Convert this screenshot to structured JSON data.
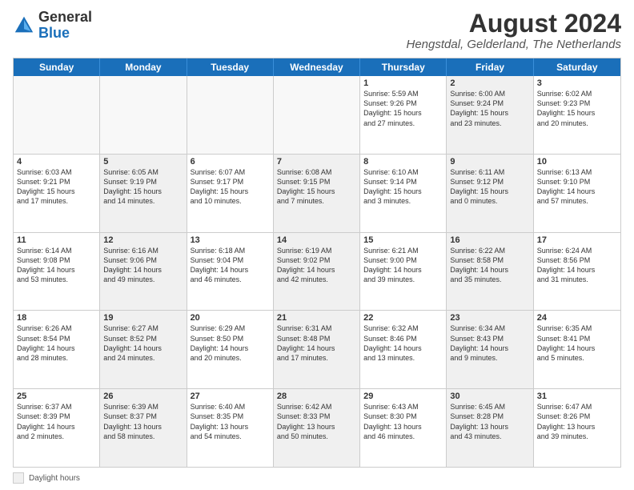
{
  "header": {
    "logo_general": "General",
    "logo_blue": "Blue",
    "main_title": "August 2024",
    "subtitle": "Hengstdal, Gelderland, The Netherlands"
  },
  "calendar": {
    "days_of_week": [
      "Sunday",
      "Monday",
      "Tuesday",
      "Wednesday",
      "Thursday",
      "Friday",
      "Saturday"
    ],
    "weeks": [
      [
        {
          "day": "",
          "empty": true
        },
        {
          "day": "",
          "empty": true
        },
        {
          "day": "",
          "empty": true
        },
        {
          "day": "",
          "empty": true
        },
        {
          "day": "1",
          "info": "Sunrise: 5:59 AM\nSunset: 9:26 PM\nDaylight: 15 hours\nand 27 minutes."
        },
        {
          "day": "2",
          "info": "Sunrise: 6:00 AM\nSunset: 9:24 PM\nDaylight: 15 hours\nand 23 minutes.",
          "shaded": true
        },
        {
          "day": "3",
          "info": "Sunrise: 6:02 AM\nSunset: 9:23 PM\nDaylight: 15 hours\nand 20 minutes."
        }
      ],
      [
        {
          "day": "4",
          "info": "Sunrise: 6:03 AM\nSunset: 9:21 PM\nDaylight: 15 hours\nand 17 minutes."
        },
        {
          "day": "5",
          "info": "Sunrise: 6:05 AM\nSunset: 9:19 PM\nDaylight: 15 hours\nand 14 minutes.",
          "shaded": true
        },
        {
          "day": "6",
          "info": "Sunrise: 6:07 AM\nSunset: 9:17 PM\nDaylight: 15 hours\nand 10 minutes."
        },
        {
          "day": "7",
          "info": "Sunrise: 6:08 AM\nSunset: 9:15 PM\nDaylight: 15 hours\nand 7 minutes.",
          "shaded": true
        },
        {
          "day": "8",
          "info": "Sunrise: 6:10 AM\nSunset: 9:14 PM\nDaylight: 15 hours\nand 3 minutes."
        },
        {
          "day": "9",
          "info": "Sunrise: 6:11 AM\nSunset: 9:12 PM\nDaylight: 15 hours\nand 0 minutes.",
          "shaded": true
        },
        {
          "day": "10",
          "info": "Sunrise: 6:13 AM\nSunset: 9:10 PM\nDaylight: 14 hours\nand 57 minutes."
        }
      ],
      [
        {
          "day": "11",
          "info": "Sunrise: 6:14 AM\nSunset: 9:08 PM\nDaylight: 14 hours\nand 53 minutes."
        },
        {
          "day": "12",
          "info": "Sunrise: 6:16 AM\nSunset: 9:06 PM\nDaylight: 14 hours\nand 49 minutes.",
          "shaded": true
        },
        {
          "day": "13",
          "info": "Sunrise: 6:18 AM\nSunset: 9:04 PM\nDaylight: 14 hours\nand 46 minutes."
        },
        {
          "day": "14",
          "info": "Sunrise: 6:19 AM\nSunset: 9:02 PM\nDaylight: 14 hours\nand 42 minutes.",
          "shaded": true
        },
        {
          "day": "15",
          "info": "Sunrise: 6:21 AM\nSunset: 9:00 PM\nDaylight: 14 hours\nand 39 minutes."
        },
        {
          "day": "16",
          "info": "Sunrise: 6:22 AM\nSunset: 8:58 PM\nDaylight: 14 hours\nand 35 minutes.",
          "shaded": true
        },
        {
          "day": "17",
          "info": "Sunrise: 6:24 AM\nSunset: 8:56 PM\nDaylight: 14 hours\nand 31 minutes."
        }
      ],
      [
        {
          "day": "18",
          "info": "Sunrise: 6:26 AM\nSunset: 8:54 PM\nDaylight: 14 hours\nand 28 minutes."
        },
        {
          "day": "19",
          "info": "Sunrise: 6:27 AM\nSunset: 8:52 PM\nDaylight: 14 hours\nand 24 minutes.",
          "shaded": true
        },
        {
          "day": "20",
          "info": "Sunrise: 6:29 AM\nSunset: 8:50 PM\nDaylight: 14 hours\nand 20 minutes."
        },
        {
          "day": "21",
          "info": "Sunrise: 6:31 AM\nSunset: 8:48 PM\nDaylight: 14 hours\nand 17 minutes.",
          "shaded": true
        },
        {
          "day": "22",
          "info": "Sunrise: 6:32 AM\nSunset: 8:46 PM\nDaylight: 14 hours\nand 13 minutes."
        },
        {
          "day": "23",
          "info": "Sunrise: 6:34 AM\nSunset: 8:43 PM\nDaylight: 14 hours\nand 9 minutes.",
          "shaded": true
        },
        {
          "day": "24",
          "info": "Sunrise: 6:35 AM\nSunset: 8:41 PM\nDaylight: 14 hours\nand 5 minutes."
        }
      ],
      [
        {
          "day": "25",
          "info": "Sunrise: 6:37 AM\nSunset: 8:39 PM\nDaylight: 14 hours\nand 2 minutes."
        },
        {
          "day": "26",
          "info": "Sunrise: 6:39 AM\nSunset: 8:37 PM\nDaylight: 13 hours\nand 58 minutes.",
          "shaded": true
        },
        {
          "day": "27",
          "info": "Sunrise: 6:40 AM\nSunset: 8:35 PM\nDaylight: 13 hours\nand 54 minutes."
        },
        {
          "day": "28",
          "info": "Sunrise: 6:42 AM\nSunset: 8:33 PM\nDaylight: 13 hours\nand 50 minutes.",
          "shaded": true
        },
        {
          "day": "29",
          "info": "Sunrise: 6:43 AM\nSunset: 8:30 PM\nDaylight: 13 hours\nand 46 minutes."
        },
        {
          "day": "30",
          "info": "Sunrise: 6:45 AM\nSunset: 8:28 PM\nDaylight: 13 hours\nand 43 minutes.",
          "shaded": true
        },
        {
          "day": "31",
          "info": "Sunrise: 6:47 AM\nSunset: 8:26 PM\nDaylight: 13 hours\nand 39 minutes."
        }
      ]
    ],
    "footer": {
      "shaded_label": "Daylight hours"
    }
  }
}
